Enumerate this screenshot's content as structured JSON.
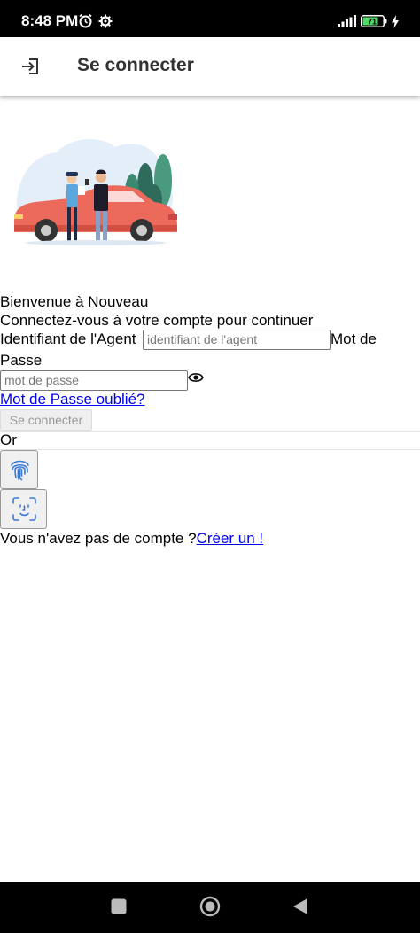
{
  "status_bar": {
    "time": "8:48 PM",
    "battery_level": "71"
  },
  "app_bar": {
    "title": "Se connecter",
    "icon": "login-icon"
  },
  "welcome": {
    "heading": "Bienvenue à Nouveau",
    "subtitle": "Connectez-vous à votre compte pour continuer"
  },
  "form": {
    "agent_label": "Identifiant de l'Agent",
    "agent_placeholder": "identifiant de l'agent",
    "password_label_1": "Mot de",
    "password_label_2": "Passe",
    "password_placeholder": "mot de passe",
    "forgot_link": "Mot de Passe oublié?",
    "submit_label": "Se connecter",
    "or_label": "Or"
  },
  "footer": {
    "no_account_text": "Vous n'avez pas de compte ?",
    "create_link": "Créer un !"
  },
  "icons": [
    "alarm-icon",
    "settings-icon",
    "signal-icon",
    "battery-icon",
    "charging-icon",
    "login-icon",
    "eye-icon",
    "fingerprint-icon",
    "face-id-icon",
    "nav-home-square-icon",
    "nav-circle-icon",
    "nav-back-icon"
  ]
}
